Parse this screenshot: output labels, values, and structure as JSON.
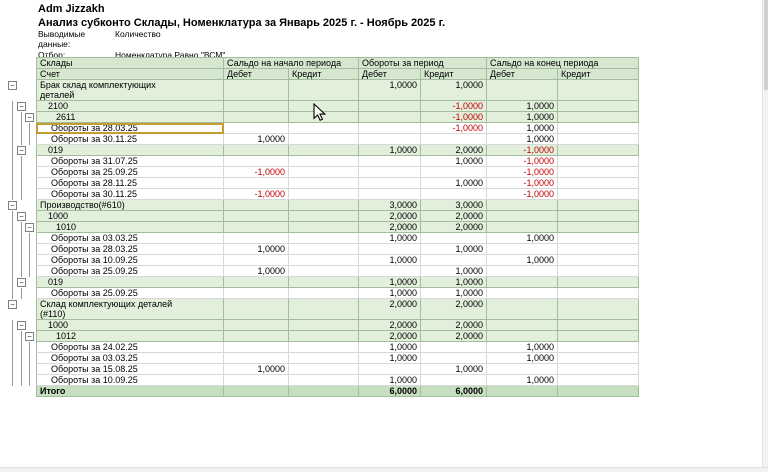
{
  "app": {
    "title": "Adm Jizzakh"
  },
  "report": {
    "title": "Анализ субконто Склады, Номенклатура за Январь 2025 г. - Ноябрь 2025 г.",
    "params": [
      {
        "label": "Выводимые данные:",
        "value": "Количество"
      },
      {
        "label": "Отбор:",
        "value": "Номенклатура Равно \"ВСМ\""
      }
    ]
  },
  "icons": {
    "collapse": "−"
  },
  "colors": {
    "row_green": "#e1efdb",
    "header_green": "#d6e7d0",
    "total_green": "#c6dfc0",
    "negative_value": "#c00000",
    "selection_border": "#c79c2e"
  },
  "table": {
    "header": {
      "corner_top": "Склады",
      "corner_bottom": "Счет",
      "groups": [
        {
          "label": "Сальдо на начало периода"
        },
        {
          "label": "Обороты за период"
        },
        {
          "label": "Сальдо на конец периода"
        }
      ],
      "subcolumns": [
        "Дебет",
        "Кредит",
        "Дебет",
        "Кредит",
        "Дебет",
        "Кредит"
      ]
    },
    "rows": [
      {
        "name": "Брак склад комплектующих\nдеталей",
        "kind": "group",
        "lvl": 1,
        "box": 1,
        "lines": [],
        "c": [
          "",
          "",
          "1,0000",
          "1,0000",
          "",
          ""
        ]
      },
      {
        "name": "2100",
        "kind": "group",
        "lvl": 2,
        "box": 2,
        "lines": [
          1
        ],
        "c": [
          "",
          "",
          "",
          "-1,0000",
          "1,0000",
          ""
        ]
      },
      {
        "name": "2611",
        "kind": "group",
        "lvl": 3,
        "box": 3,
        "lines": [
          1,
          2
        ],
        "c": [
          "",
          "",
          "",
          "-1,0000",
          "1,0000",
          ""
        ]
      },
      {
        "name": "Обороты за 28.03.25",
        "kind": "detail",
        "lines": [
          1,
          2,
          3
        ],
        "sel": true,
        "c": [
          "",
          "",
          "",
          "-1,0000",
          "1,0000",
          ""
        ]
      },
      {
        "name": "Обороты за 30.11.25",
        "kind": "detail",
        "lines": [
          1,
          2,
          3
        ],
        "c": [
          "1,0000",
          "",
          "",
          "",
          "1,0000",
          ""
        ]
      },
      {
        "name": "019",
        "kind": "group",
        "lvl": 2,
        "box": 2,
        "lines": [
          1
        ],
        "c": [
          "",
          "",
          "1,0000",
          "2,0000",
          "-1,0000",
          ""
        ]
      },
      {
        "name": "Обороты за 31.07.25",
        "kind": "detail",
        "lines": [
          1,
          2
        ],
        "c": [
          "",
          "",
          "",
          "1,0000",
          "-1,0000",
          ""
        ]
      },
      {
        "name": "Обороты за 25.09.25",
        "kind": "detail",
        "lines": [
          1,
          2
        ],
        "c": [
          "-1,0000",
          "",
          "",
          "",
          "-1,0000",
          ""
        ]
      },
      {
        "name": "Обороты за 28.11.25",
        "kind": "detail",
        "lines": [
          1,
          2
        ],
        "c": [
          "",
          "",
          "",
          "1,0000",
          "-1,0000",
          ""
        ]
      },
      {
        "name": "Обороты за 30.11.25",
        "kind": "detail",
        "lines": [
          1,
          2
        ],
        "c": [
          "-1,0000",
          "",
          "",
          "",
          "-1,0000",
          ""
        ]
      },
      {
        "name": "Производство(#610)",
        "kind": "group",
        "lvl": 1,
        "box": 1,
        "lines": [],
        "c": [
          "",
          "",
          "3,0000",
          "3,0000",
          "",
          ""
        ]
      },
      {
        "name": "1000",
        "kind": "group",
        "lvl": 2,
        "box": 2,
        "lines": [
          1
        ],
        "c": [
          "",
          "",
          "2,0000",
          "2,0000",
          "",
          ""
        ]
      },
      {
        "name": "1010",
        "kind": "group",
        "lvl": 3,
        "box": 3,
        "lines": [
          1,
          2
        ],
        "c": [
          "",
          "",
          "2,0000",
          "2,0000",
          "",
          ""
        ]
      },
      {
        "name": "Обороты за 03.03.25",
        "kind": "detail",
        "lines": [
          1,
          2,
          3
        ],
        "c": [
          "",
          "",
          "1,0000",
          "",
          "1,0000",
          ""
        ]
      },
      {
        "name": "Обороты за 28.03.25",
        "kind": "detail",
        "lines": [
          1,
          2,
          3
        ],
        "c": [
          "1,0000",
          "",
          "",
          "1,0000",
          "",
          ""
        ]
      },
      {
        "name": "Обороты за 10.09.25",
        "kind": "detail",
        "lines": [
          1,
          2,
          3
        ],
        "c": [
          "",
          "",
          "1,0000",
          "",
          "1,0000",
          ""
        ]
      },
      {
        "name": "Обороты за 25.09.25",
        "kind": "detail",
        "lines": [
          1,
          2,
          3
        ],
        "c": [
          "1,0000",
          "",
          "",
          "1,0000",
          "",
          ""
        ]
      },
      {
        "name": "019",
        "kind": "group",
        "lvl": 2,
        "box": 2,
        "lines": [
          1
        ],
        "c": [
          "",
          "",
          "1,0000",
          "1,0000",
          "",
          ""
        ]
      },
      {
        "name": "Обороты за 25.09.25",
        "kind": "detail",
        "lines": [
          1,
          2
        ],
        "c": [
          "",
          "",
          "1,0000",
          "1,0000",
          "",
          ""
        ]
      },
      {
        "name": "Склад комплектующих деталей\n(#110)",
        "kind": "group",
        "lvl": 1,
        "box": 1,
        "lines": [],
        "c": [
          "",
          "",
          "2,0000",
          "2,0000",
          "",
          ""
        ]
      },
      {
        "name": "1000",
        "kind": "group",
        "lvl": 2,
        "box": 2,
        "lines": [
          1
        ],
        "c": [
          "",
          "",
          "2,0000",
          "2,0000",
          "",
          ""
        ]
      },
      {
        "name": "1012",
        "kind": "group",
        "lvl": 3,
        "box": 3,
        "lines": [
          1,
          2
        ],
        "c": [
          "",
          "",
          "2,0000",
          "2,0000",
          "",
          ""
        ]
      },
      {
        "name": "Обороты за 24.02.25",
        "kind": "detail",
        "lines": [
          1,
          2,
          3
        ],
        "c": [
          "",
          "",
          "1,0000",
          "",
          "1,0000",
          ""
        ]
      },
      {
        "name": "Обороты за 03.03.25",
        "kind": "detail",
        "lines": [
          1,
          2,
          3
        ],
        "c": [
          "",
          "",
          "1,0000",
          "",
          "1,0000",
          ""
        ]
      },
      {
        "name": "Обороты за 15.08.25",
        "kind": "detail",
        "lines": [
          1,
          2,
          3
        ],
        "c": [
          "1,0000",
          "",
          "",
          "1,0000",
          "",
          ""
        ]
      },
      {
        "name": "Обороты за 10.09.25",
        "kind": "detail",
        "lines": [
          1,
          2,
          3
        ],
        "c": [
          "",
          "",
          "1,0000",
          "",
          "1,0000",
          ""
        ]
      },
      {
        "name": "Итого",
        "kind": "total",
        "lvl": "t",
        "lines": [],
        "c": [
          "",
          "",
          "6,0000",
          "6,0000",
          "",
          ""
        ]
      }
    ]
  }
}
